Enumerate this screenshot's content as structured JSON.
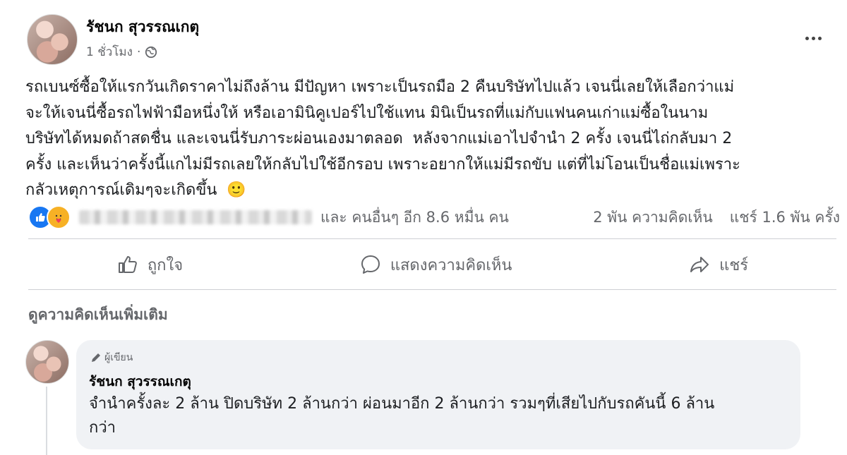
{
  "post": {
    "author": "รัชนก สุวรรณเกตุ",
    "time": "1 ชั่วโมง",
    "separator": "·",
    "text_lines": [
      "รถเบนซ์ซื้อให้แรกวันเกิดราคาไม่ถึงล้าน มีปัญหา เพราะเป็นรถมือ 2 คืนบริษัทไปแล้ว เจนนี่เลยให้เลือกว่าแม่",
      "จะให้เจนนี่ซื้อรถไฟฟ้ามือหนึ่งให้ หรือเอามินิคูเปอร์ไปใช้แทน มินิเป็นรถที่แม่กับแฟนคนเก่าแม่ซื้อในนาม",
      "บริษัทได้หมดถ้าสดชื่น และเจนนี่รับภาระผ่อนเองมาตลอด  หลังจากแม่เอาไปจำนำ 2 ครั้ง เจนนี่ไถ่กลับมา 2",
      "ครั้ง และเห็นว่าครั้งนี้แกไม่มีรถเลยให้กลับไปใช้อีกรอบ เพราะอยากให้แม่มีรถขับ แต่ที่ไม่โอนเป็นชื่อแม่เพราะ",
      "กลัวเหตุการณ์เดิมๆจะเกิดขึ้น  🙂"
    ]
  },
  "reactions": {
    "others": "และ คนอื่นๆ อีก 8.6 หมื่น คน",
    "comments": "2 พัน ความคิดเห็น",
    "shares": "แชร์ 1.6 พัน ครั้ง"
  },
  "actions": {
    "like": "ถูกใจ",
    "comment": "แสดงความคิดเห็น",
    "share": "แชร์"
  },
  "more_comments": "ดูความคิดเห็นเพิ่มเติม",
  "comment": {
    "badge": "ผู้เขียน",
    "author": "รัชนก สุวรรณเกตุ",
    "text_lines": [
      "จำนำครั้งละ 2 ล้าน ปิดบริษัท 2 ล้านกว่า ผ่อนมาอีก 2 ล้านกว่า รวมๆที่เสียไปกับรถคันนี้ 6 ล้าน",
      "กว่า"
    ]
  },
  "icons": {
    "globe": "globe-icon",
    "more": "more-dots-icon",
    "like_reaction": "like-reaction-icon",
    "care_reaction": "care-reaction-icon",
    "like_action": "thumbs-up-icon",
    "comment_action": "comment-bubble-icon",
    "share_action": "share-arrow-icon",
    "pencil": "pencil-icon"
  },
  "colors": {
    "accent": "#1877f2",
    "care": "#f7b125",
    "secondary_text": "#65676b",
    "bubble": "#f0f2f5"
  }
}
